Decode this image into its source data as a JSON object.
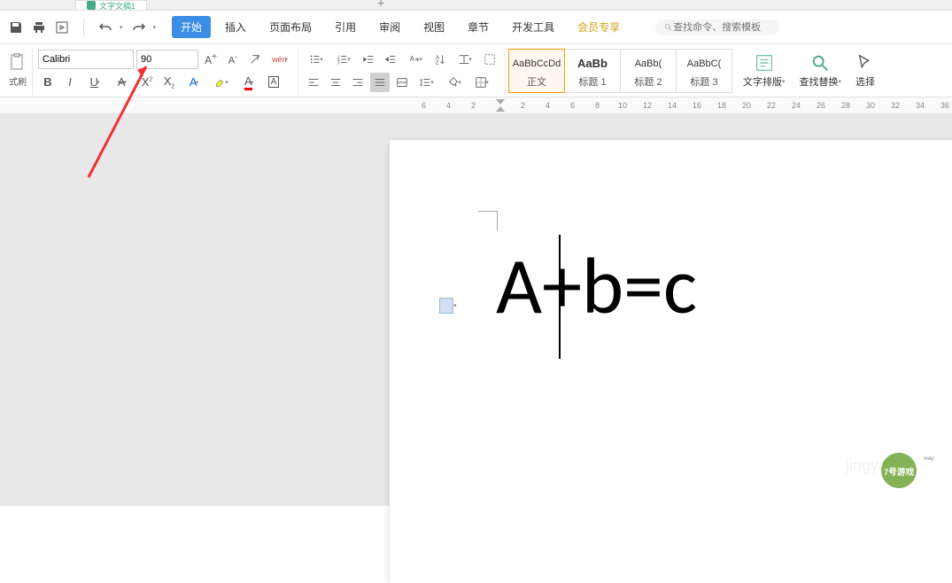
{
  "tab": {
    "title": "文字文稿1"
  },
  "menu": {
    "start": "开始",
    "insert": "插入",
    "layout": "页面布局",
    "reference": "引用",
    "review": "审阅",
    "view": "视图",
    "chapter": "章节",
    "devtools": "开发工具",
    "member": "会员专享"
  },
  "search": {
    "placeholder": "查找命令、搜索模板"
  },
  "font": {
    "name": "Calibri",
    "size": "90"
  },
  "format_painter": "式刷",
  "styles": [
    {
      "preview": "AaBbCcDd",
      "label": "正文",
      "bold": false,
      "active": true
    },
    {
      "preview": "AaBb",
      "label": "标题 1",
      "bold": true,
      "active": false
    },
    {
      "preview": "AaBb(",
      "label": "标题 2",
      "bold": false,
      "active": false
    },
    {
      "preview": "AaBbC(",
      "label": "标题 3",
      "bold": false,
      "active": false
    }
  ],
  "big_buttons": {
    "text_layout": "文字排版",
    "find_replace": "查找替换",
    "select": "选择"
  },
  "ruler_ticks": [
    "6",
    "4",
    "2",
    "",
    "2",
    "4",
    "6",
    "8",
    "10",
    "12",
    "14",
    "16",
    "18",
    "20",
    "22",
    "24",
    "26",
    "28",
    "30",
    "32",
    "34",
    "36"
  ],
  "document": {
    "text": "A+b=c"
  },
  "watermark": {
    "brand": "7号游戏",
    "sub": "jingyan",
    "site": "xiayx.com"
  }
}
